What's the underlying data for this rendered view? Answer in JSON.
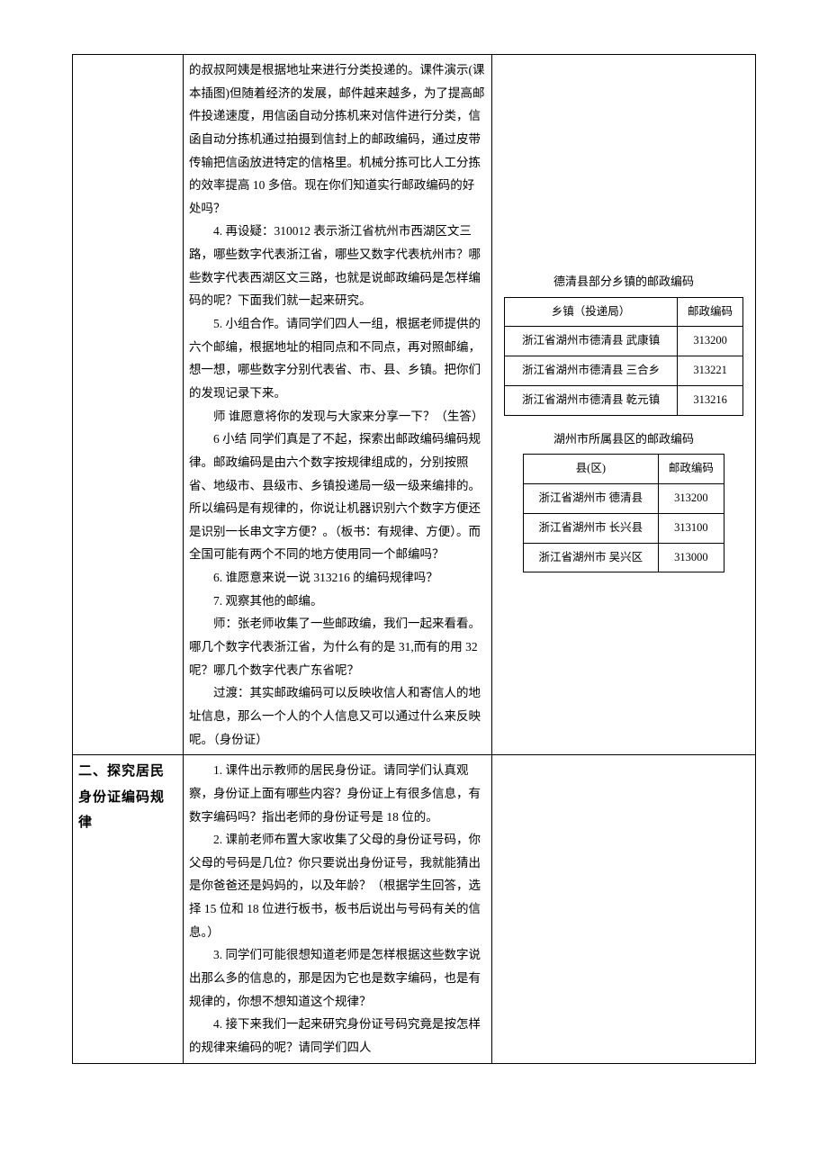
{
  "row1": {
    "mid": {
      "p1": "的叔叔阿姨是根据地址来进行分类投递的。课件演示(课本插图)但随着经济的发展，邮件越来越多，为了提高邮件投递速度，用信函自动分拣机来对信件进行分类，信函自动分拣机通过拍摄到信封上的邮政编码，通过皮带传输把信函放进特定的信格里。机械分拣可比人工分拣的效率提高 10 多倍。现在你们知道实行邮政编码的好处吗？",
      "p2": "4. 再设疑：310012 表示浙江省杭州市西湖区文三路，哪些数字代表浙江省，哪些又数字代表杭州市？哪些数字代表西湖区文三路，也就是说邮政编码是怎样编码的呢？下面我们就一起来研究。",
      "p3": "5. 小组合作。请同学们四人一组，根据老师提供的六个邮编，根据地址的相同点和不同点，再对照邮编，想一想，哪些数字分别代表省、市、县、乡镇。把你们的发现记录下来。",
      "p4": "师 谁愿意将你的发现与大家来分享一下？（生答）",
      "p5": "6 小结 同学们真是了不起，探索出邮政编码编码规律。邮政编码是由六个数字按规律组成的，分别按照省、地级市、县级市、乡镇投递局一级一级来编排的。所以编码是有规律的，你说让机器识别六个数字方便还是识别一长串文字方便？。（板书：有规律、方便）。而全国可能有两个不同的地方使用同一个邮编吗？",
      "p6": "6. 谁愿意来说一说 313216 的编码规律吗？",
      "p7": "7. 观察其他的邮编。",
      "p8": "师：张老师收集了一些邮政编，我们一起来看看。哪几个数字代表浙江省，为什么有的是 31,而有的用 32 呢？哪几个数字代表广东省呢？",
      "p9": "过渡：其实邮政编码可以反映收信人和寄信人的地址信息，那么一个人的个人信息又可以通过什么来反映呢。（身份证）"
    },
    "right": {
      "title1": "德清县部分乡镇的邮政编码",
      "table1": {
        "headers": [
          "乡镇（投递局）",
          "邮政编码"
        ],
        "rows": [
          [
            "浙江省湖州市德清县 武康镇",
            "313200"
          ],
          [
            "浙江省湖州市德清县 三合乡",
            "313221"
          ],
          [
            "浙江省湖州市德清县 乾元镇",
            "313216"
          ]
        ]
      },
      "title2": "湖州市所属县区的邮政编码",
      "table2": {
        "headers": [
          "县(区)",
          "邮政编码"
        ],
        "rows": [
          [
            "浙江省湖州市 德清县",
            "313200"
          ],
          [
            "浙江省湖州市 长兴县",
            "313100"
          ],
          [
            "浙江省湖州市 吴兴区",
            "313000"
          ]
        ]
      }
    }
  },
  "row2": {
    "left": "二、探究居民身份证编码规律",
    "mid": {
      "p1": "1. 课件出示教师的居民身份证。请同学们认真观察，身份证上面有哪些内容？身份证上有很多信息，有数字编码吗？指出老师的身份证号是 18 位的。",
      "p2": "2. 课前老师布置大家收集了父母的身份证号码，你父母的号码是几位？你只要说出身份证号，我就能猜出是你爸爸还是妈妈的，以及年龄？（根据学生回答，选择 15 位和 18 位进行板书，板书后说出与号码有关的信息。）",
      "p3": "3. 同学们可能很想知道老师是怎样根据这些数字说出那么多的信息的，那是因为它也是数字编码，也是有规律的，你想不想知道这个规律？",
      "p4": "4. 接下来我们一起来研究身份证号码究竟是按怎样的规律来编码的呢？请同学们四人"
    }
  }
}
